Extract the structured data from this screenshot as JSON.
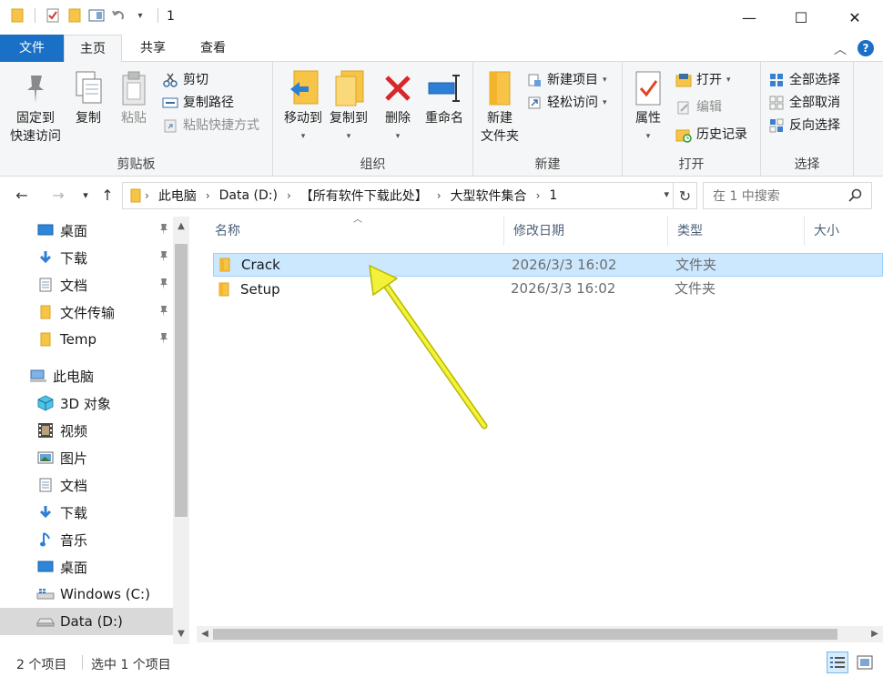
{
  "window": {
    "title": "1",
    "minimize_glyph": "—",
    "maximize_glyph": "☐",
    "close_glyph": "✕"
  },
  "ribbon_tabs": {
    "file": "文件",
    "home": "主页",
    "share": "共享",
    "view": "查看"
  },
  "ribbon": {
    "clipboard": {
      "label": "剪贴板",
      "pin_line1": "固定到",
      "pin_line2": "快速访问",
      "copy": "复制",
      "paste": "粘贴",
      "cut": "剪切",
      "copy_path": "复制路径",
      "paste_shortcut": "粘贴快捷方式"
    },
    "organize": {
      "label": "组织",
      "move_to": "移动到",
      "copy_to": "复制到",
      "delete": "删除",
      "rename": "重命名"
    },
    "new": {
      "label": "新建",
      "new_folder_line1": "新建",
      "new_folder_line2": "文件夹",
      "new_item": "新建项目",
      "easy_access": "轻松访问"
    },
    "open": {
      "label": "打开",
      "properties": "属性",
      "open": "打开",
      "edit": "编辑",
      "history": "历史记录"
    },
    "select": {
      "label": "选择",
      "select_all": "全部选择",
      "select_none": "全部取消",
      "invert": "反向选择"
    }
  },
  "address": {
    "crumbs": [
      "此电脑",
      "Data (D:)",
      "【所有软件下载此处】",
      "大型软件集合",
      "1"
    ],
    "search_placeholder": "在 1 中搜索"
  },
  "nav_pane": {
    "quick_access": [
      {
        "label": "桌面",
        "icon": "desktop-icon"
      },
      {
        "label": "下载",
        "icon": "download-icon"
      },
      {
        "label": "文档",
        "icon": "document-icon"
      },
      {
        "label": "文件传输",
        "icon": "folder-icon"
      },
      {
        "label": "Temp",
        "icon": "folder-icon"
      }
    ],
    "this_pc": "此电脑",
    "pc_items": [
      {
        "label": "3D 对象",
        "icon": "3d-objects-icon"
      },
      {
        "label": "视频",
        "icon": "video-icon"
      },
      {
        "label": "图片",
        "icon": "picture-icon"
      },
      {
        "label": "文档",
        "icon": "document-icon"
      },
      {
        "label": "下载",
        "icon": "download-icon"
      },
      {
        "label": "音乐",
        "icon": "music-icon"
      },
      {
        "label": "桌面",
        "icon": "desktop-icon"
      },
      {
        "label": "Windows (C:)",
        "icon": "windows-drive-icon"
      },
      {
        "label": "Data (D:)",
        "icon": "drive-icon"
      }
    ]
  },
  "columns": {
    "name": "名称",
    "modified": "修改日期",
    "type": "类型",
    "size": "大小"
  },
  "files": [
    {
      "name": "Crack",
      "modified": "2026/3/3 16:02",
      "type": "文件夹",
      "selected": true
    },
    {
      "name": "Setup",
      "modified": "2026/3/3 16:02",
      "type": "文件夹",
      "selected": false
    }
  ],
  "status": {
    "count": "2 个项目",
    "selection": "选中 1 个项目"
  },
  "colors": {
    "accent": "#1a6fc7",
    "selection_bg": "#cce8ff",
    "folder": "#f8c447",
    "annotation_arrow": "#f2f23a"
  }
}
